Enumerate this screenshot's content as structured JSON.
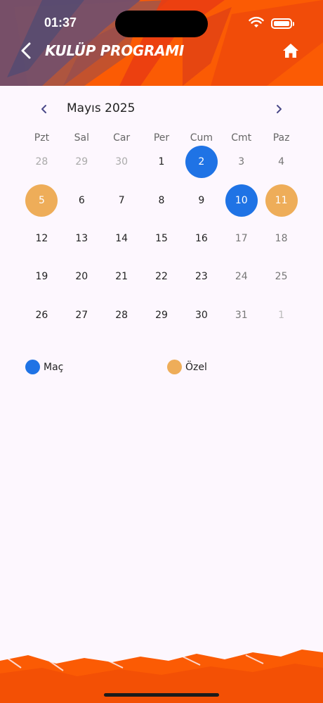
{
  "status_bar": {
    "time": "01:37"
  },
  "header": {
    "title": "KULÜP PROGRAMI"
  },
  "calendar": {
    "month_label": "Mayıs 2025",
    "weekdays": [
      "Pzt",
      "Sal",
      "Car",
      "Per",
      "Cum",
      "Cmt",
      "Paz"
    ],
    "weeks": [
      [
        {
          "d": "28",
          "muted": true
        },
        {
          "d": "29",
          "muted": true
        },
        {
          "d": "30",
          "muted": true
        },
        {
          "d": "1"
        },
        {
          "d": "2",
          "event": "mac"
        },
        {
          "d": "3",
          "weekend": true
        },
        {
          "d": "4",
          "weekend": true
        }
      ],
      [
        {
          "d": "5",
          "event": "ozel"
        },
        {
          "d": "6"
        },
        {
          "d": "7"
        },
        {
          "d": "8"
        },
        {
          "d": "9"
        },
        {
          "d": "10",
          "event": "mac"
        },
        {
          "d": "11",
          "event": "ozel"
        }
      ],
      [
        {
          "d": "12"
        },
        {
          "d": "13"
        },
        {
          "d": "14"
        },
        {
          "d": "15"
        },
        {
          "d": "16"
        },
        {
          "d": "17",
          "weekend": true
        },
        {
          "d": "18",
          "weekend": true
        }
      ],
      [
        {
          "d": "19"
        },
        {
          "d": "20"
        },
        {
          "d": "21"
        },
        {
          "d": "22"
        },
        {
          "d": "23"
        },
        {
          "d": "24",
          "weekend": true
        },
        {
          "d": "25",
          "weekend": true
        }
      ],
      [
        {
          "d": "26"
        },
        {
          "d": "27"
        },
        {
          "d": "28"
        },
        {
          "d": "29"
        },
        {
          "d": "30"
        },
        {
          "d": "31",
          "weekend": true
        },
        {
          "d": "1",
          "muted": true,
          "weekend": true
        }
      ]
    ]
  },
  "legend": {
    "mac_label": "Maç",
    "ozel_label": "Özel"
  },
  "colors": {
    "brand_orange": "#fb5b04",
    "mac": "#1f73e5",
    "ozel": "#eead59"
  }
}
